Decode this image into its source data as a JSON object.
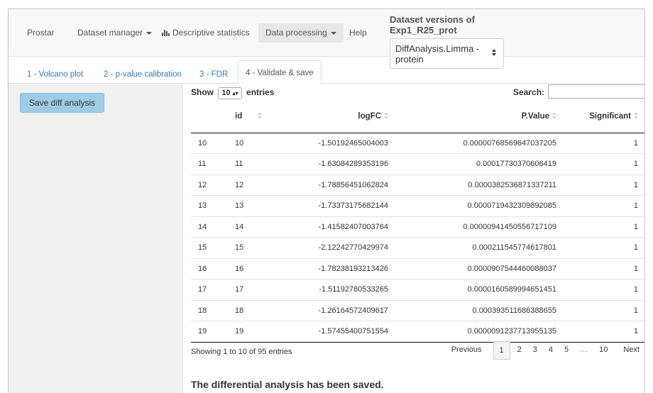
{
  "navbar": {
    "brand": "Prostar",
    "dataset_manager": "Dataset manager",
    "descriptive_statistics": "Descriptive statistics",
    "data_processing": "Data processing",
    "help": "Help"
  },
  "dataset_versions": {
    "title_line1": "Dataset versions of",
    "title_line2": "Exp1_R25_prot",
    "selected_line1": "DiffAnalysis.Limma -",
    "selected_line2": "protein"
  },
  "tabs": [
    {
      "label": "1 - Volcano plot"
    },
    {
      "label": "2 - p-value calibration"
    },
    {
      "label": "3 - FDR"
    },
    {
      "label": "4 - Validate & save"
    }
  ],
  "sidebar": {
    "save_button": "Save diff analysis"
  },
  "table_controls": {
    "show_label": "Show",
    "page_length": "10",
    "entries_label": "entries",
    "search_label": "Search:",
    "search_value": ""
  },
  "table": {
    "headers": [
      "",
      "id",
      "logFC",
      "P.Value",
      "Significant"
    ],
    "rows": [
      [
        "10",
        "10",
        "-1.50192465004003",
        "0.00000768569647037205",
        "1"
      ],
      [
        "11",
        "11",
        "-1.63084289353196",
        "0.00017730370606419",
        "1"
      ],
      [
        "12",
        "12",
        "-1.78856451062824",
        "0.0000382536871337211",
        "1"
      ],
      [
        "13",
        "13",
        "-1.73373175682144",
        "0.0000719432309892085",
        "1"
      ],
      [
        "14",
        "14",
        "-1.41582407003764",
        "0.00000941450556717109",
        "1"
      ],
      [
        "15",
        "15",
        "-2.12242770429974",
        "0.000211545774617801",
        "1"
      ],
      [
        "16",
        "16",
        "-1.78238193213426",
        "0.0000907544460088037",
        "1"
      ],
      [
        "17",
        "17",
        "-1.51192780533265",
        "0.0000160589994651451",
        "1"
      ],
      [
        "18",
        "18",
        "-1.26164572409617",
        "0.000393511686388655",
        "1"
      ],
      [
        "19",
        "19",
        "-1.57455400751554",
        "0.0000091237713955135",
        "1"
      ]
    ]
  },
  "info_text": "Showing 1 to 10 of 95 entries",
  "pagination": {
    "previous": "Previous",
    "pages": [
      "1",
      "2",
      "3",
      "4",
      "5",
      "…",
      "10"
    ],
    "current": "1",
    "next": "Next"
  },
  "status_message": "The differential analysis has been saved.",
  "colors": {
    "accent_button": "#9ecbe6",
    "link": "#337ab7",
    "navbar_bg": "#f8f8f8",
    "sidebar_bg": "#f0f0f0"
  }
}
